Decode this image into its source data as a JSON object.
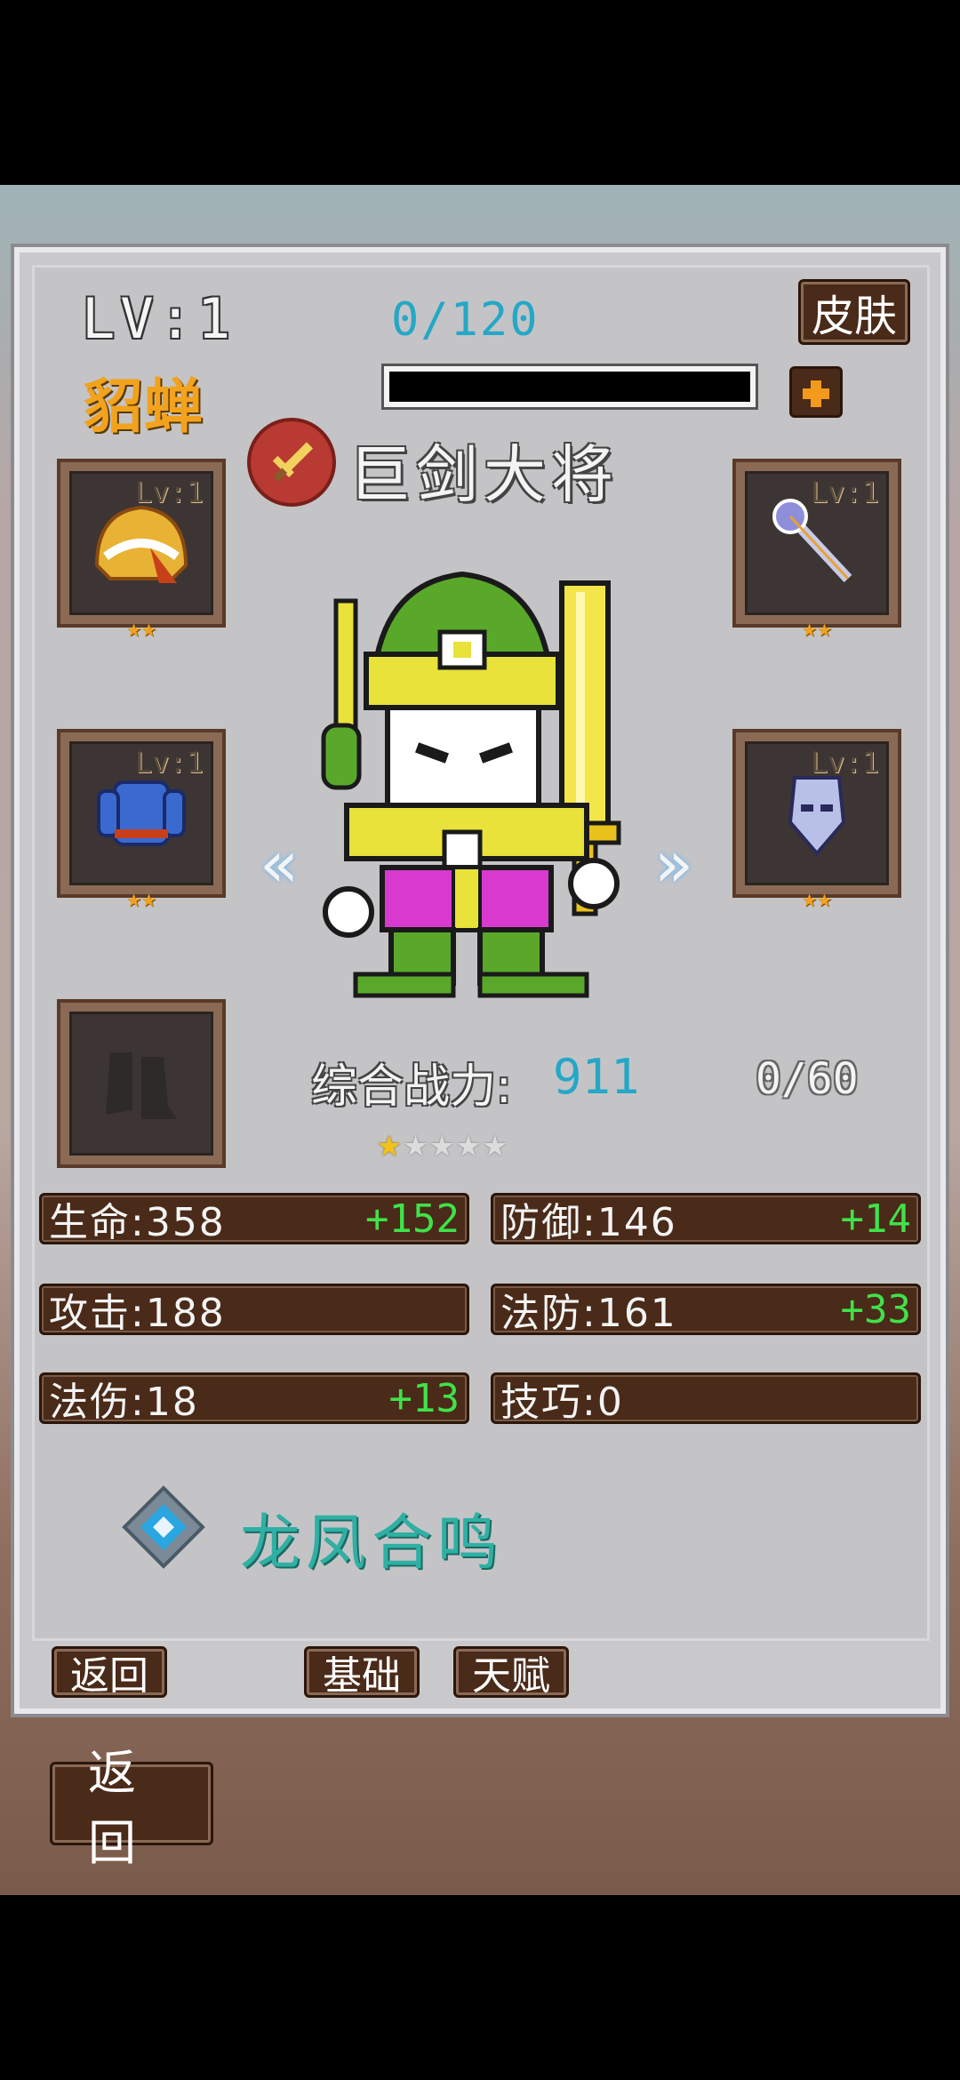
{
  "hero": {
    "level_text": "LV:1",
    "name": "貂蝉",
    "exp_text": "0/120",
    "exp_progress": 0,
    "class_name": "巨剑大将",
    "class_icon": "sword-icon"
  },
  "buttons": {
    "skin": "皮肤",
    "add": "plus-icon",
    "back": "返回",
    "basic": "基础",
    "talent": "天赋",
    "bottom_back": "返回"
  },
  "equipment": [
    {
      "slot": "helmet",
      "level": "Lv:1",
      "stars": "★★",
      "icon": "helmet-icon"
    },
    {
      "slot": "weapon",
      "level": "Lv:1",
      "stars": "★★",
      "icon": "staff-icon"
    },
    {
      "slot": "armor",
      "level": "Lv:1",
      "stars": "★★",
      "icon": "armor-icon"
    },
    {
      "slot": "accessory",
      "level": "Lv:1",
      "stars": "★★",
      "icon": "mask-icon"
    },
    {
      "slot": "boots",
      "level": "",
      "stars": "",
      "icon": "boots-icon"
    }
  ],
  "power": {
    "label": "综合战力:",
    "value": "911",
    "shards": "0/60",
    "star_rating": 1,
    "star_max": 5
  },
  "stats": [
    {
      "label": "生命:358",
      "bonus": "+152"
    },
    {
      "label": "防御:146",
      "bonus": "+14"
    },
    {
      "label": "攻击:188",
      "bonus": ""
    },
    {
      "label": "法防:161",
      "bonus": "+33"
    },
    {
      "label": "法伤:18",
      "bonus": "+13"
    },
    {
      "label": "技巧:0",
      "bonus": ""
    }
  ],
  "bond": {
    "name": "龙凤合鸣",
    "icon": "diamond-icon"
  },
  "colors": {
    "name": "#f2a21c",
    "exp": "#26a7c6",
    "bonus": "#3fe24a",
    "bond": "#2fb0a4"
  }
}
